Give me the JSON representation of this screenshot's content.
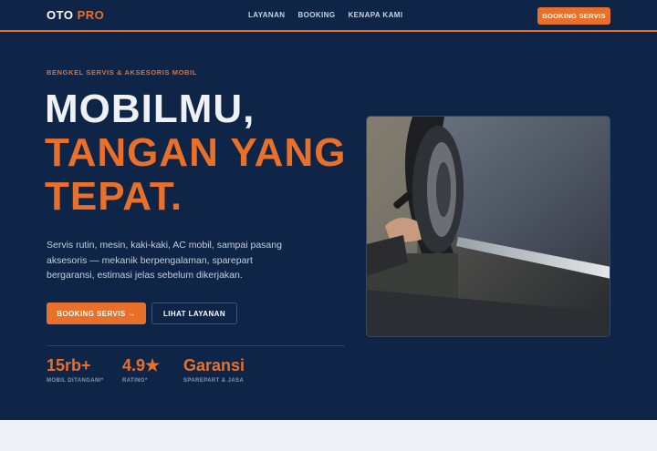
{
  "nav": {
    "logo_main": "OTO",
    "logo_accent": "PRO",
    "links": [
      "LAYANAN",
      "BOOKING",
      "KENAPA KAMI"
    ],
    "cta": "BOOKING SERVIS"
  },
  "hero": {
    "eyebrow": "BENGKEL SERVIS & AKSESORIS MOBIL",
    "headline_line1": "MOBILMU,",
    "headline_line2": "TANGAN YANG",
    "headline_line3": "TEPAT.",
    "description": "Servis rutin, mesin, kaki-kaki, AC mobil, sampai pasang aksesoris — mekanik berpengalaman, sparepart bergaransi, estimasi jelas sebelum dikerjakan.",
    "primary_button": "BOOKING SERVIS →",
    "secondary_button": "LIHAT LAYANAN"
  },
  "stats": [
    {
      "value": "15rb+",
      "label": "MOBIL DITANGANI*"
    },
    {
      "value": "4.9★",
      "label": "RATING*"
    },
    {
      "value": "Garansi",
      "label": "SPAREPART & JASA"
    }
  ],
  "colors": {
    "background": "#0f2547",
    "accent": "#e8702a",
    "text_light": "#eef1f6",
    "footer_strip": "#eef1f5"
  }
}
